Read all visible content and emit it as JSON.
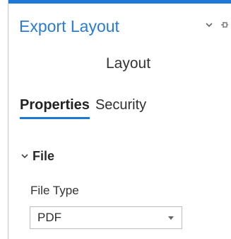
{
  "pane": {
    "title": "Export Layout",
    "subtitle": "Layout",
    "accent_color": "#1e78d7",
    "title_color": "#2b7bd0",
    "actions": [
      {
        "icon": "dropdown-menu-icon"
      },
      {
        "icon": "pin-icon"
      }
    ]
  },
  "tabs": [
    {
      "label": "Properties",
      "active": true
    },
    {
      "label": "Security",
      "active": false
    }
  ],
  "section": {
    "label": "File",
    "expanded": true,
    "icon": "chevron-down-icon"
  },
  "fields": {
    "file_type": {
      "label": "File Type",
      "value": "PDF"
    }
  }
}
